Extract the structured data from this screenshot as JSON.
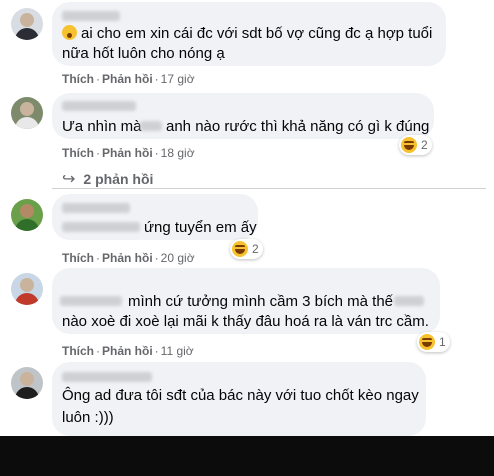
{
  "comments": [
    {
      "lines": [
        "ai cho em xin cái đc với sdt bố vợ cũng đc ạ hợp tuổi",
        "nữa hốt luôn cho nóng ạ"
      ],
      "meta": {
        "like": "Thích",
        "reply": "Phản hồi",
        "time": "17 giờ"
      },
      "emoji_icon": "pleading-face-icon"
    },
    {
      "lines": [
        "Ưa nhìn mà",
        "anh nào rước thì khả năng có gì k đúng"
      ],
      "meta": {
        "like": "Thích",
        "reply": "Phản hồi",
        "time": "18 giờ"
      },
      "reaction": {
        "icon": "haha-icon",
        "count": "2"
      },
      "replies_label": "2 phản hồi"
    },
    {
      "lines": [
        "ứng tuyển em ấy"
      ],
      "meta": {
        "like": "Thích",
        "reply": "Phản hồi",
        "time": "20 giờ"
      },
      "reaction": {
        "icon": "haha-icon",
        "count": "2"
      }
    },
    {
      "lines": [
        "mình cứ tưởng mình cầm 3 bích mà thế",
        "nào xoè đi xoè lại mãi k thấy đâu hoá ra là ván trc cầm."
      ],
      "meta": {
        "like": "Thích",
        "reply": "Phản hồi",
        "time": "11 giờ"
      },
      "reaction": {
        "icon": "haha-icon",
        "count": "1"
      }
    },
    {
      "lines": [
        "Ông ad đưa tôi sđt của bác này với tuo chốt kèo ngay",
        "luôn :)))"
      ]
    }
  ],
  "colors": {
    "bubble": "#f0f2f5",
    "meta": "#65676b",
    "haha": "#f7c22f"
  }
}
